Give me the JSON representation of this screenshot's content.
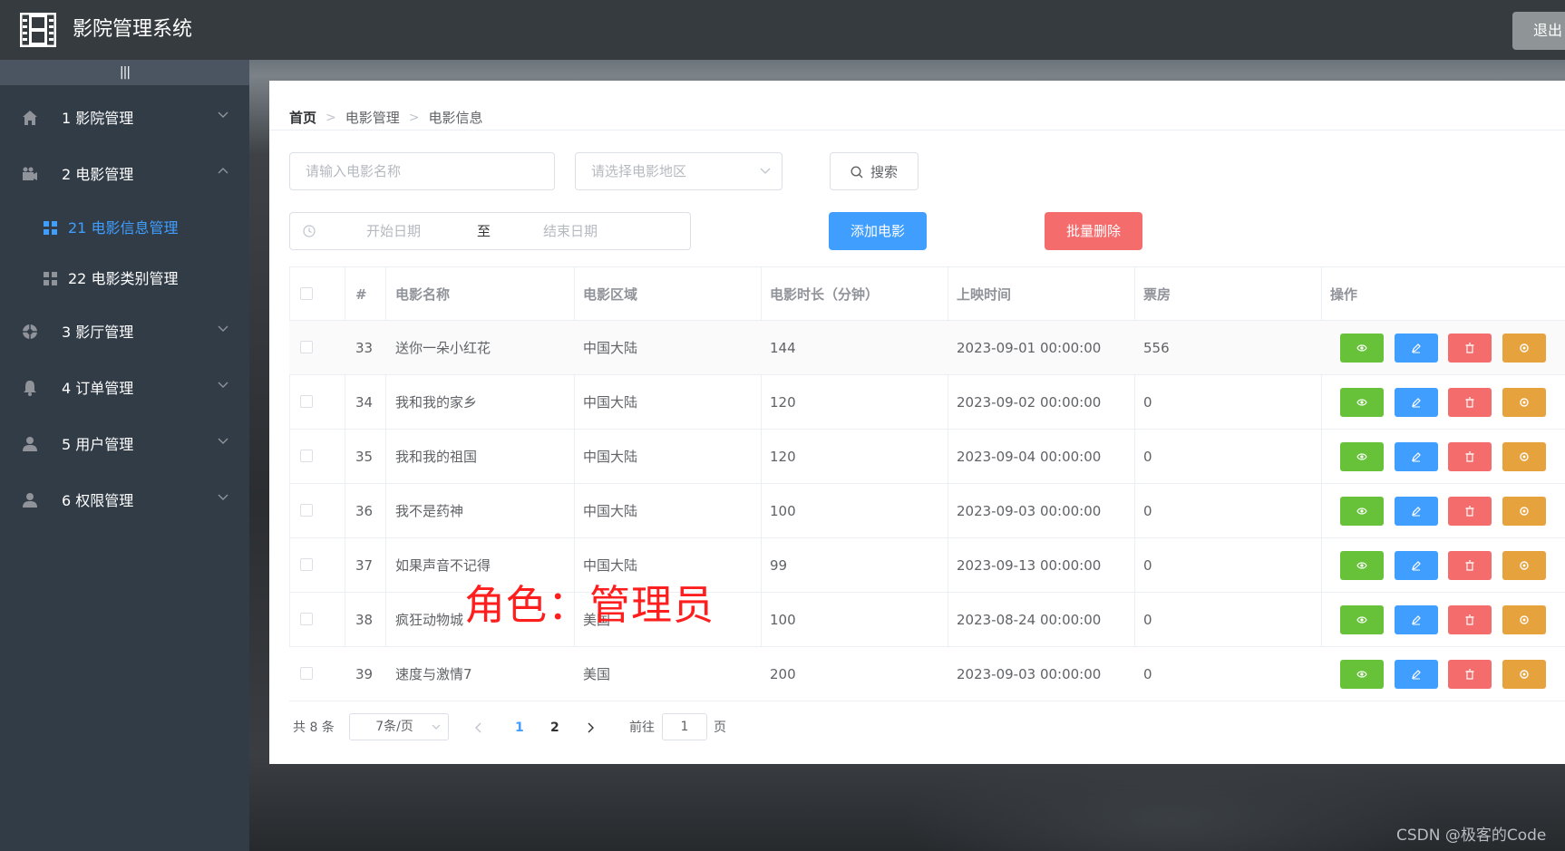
{
  "app": {
    "title": "影院管理系统",
    "logout_label": "退出"
  },
  "sidebar": {
    "collapse_glyph": "|||",
    "items": [
      {
        "label": "1 影院管理",
        "icon": "home-icon"
      },
      {
        "label": "2 电影管理",
        "icon": "camera-icon",
        "expanded": true,
        "children": [
          {
            "label": "21 电影信息管理",
            "active": true
          },
          {
            "label": "22 电影类别管理",
            "active": false
          }
        ]
      },
      {
        "label": "3 影厅管理",
        "icon": "disc-icon"
      },
      {
        "label": "4 订单管理",
        "icon": "bell-icon"
      },
      {
        "label": "5 用户管理",
        "icon": "user-icon"
      },
      {
        "label": "6 权限管理",
        "icon": "user-icon"
      }
    ]
  },
  "breadcrumb": [
    "首页",
    "电影管理",
    "电影信息"
  ],
  "filters": {
    "name_placeholder": "请输入电影名称",
    "region_placeholder": "请选择电影地区",
    "search_label": "搜索",
    "start_date_placeholder": "开始日期",
    "range_separator": "至",
    "end_date_placeholder": "结束日期",
    "add_label": "添加电影",
    "batch_delete_label": "批量删除"
  },
  "table": {
    "columns": [
      "#",
      "电影名称",
      "电影区域",
      "电影时长（分钟）",
      "上映时间",
      "票房",
      "操作"
    ],
    "rows": [
      {
        "id": "33",
        "name": "送你一朵小红花",
        "region": "中国大陆",
        "duration": "144",
        "release": "2023-09-01 00:00:00",
        "box_office": "556"
      },
      {
        "id": "34",
        "name": "我和我的家乡",
        "region": "中国大陆",
        "duration": "120",
        "release": "2023-09-02 00:00:00",
        "box_office": "0"
      },
      {
        "id": "35",
        "name": "我和我的祖国",
        "region": "中国大陆",
        "duration": "120",
        "release": "2023-09-04 00:00:00",
        "box_office": "0"
      },
      {
        "id": "36",
        "name": "我不是药神",
        "region": "中国大陆",
        "duration": "100",
        "release": "2023-09-03 00:00:00",
        "box_office": "0"
      },
      {
        "id": "37",
        "name": "如果声音不记得",
        "region": "中国大陆",
        "duration": "99",
        "release": "2023-09-13 00:00:00",
        "box_office": "0"
      },
      {
        "id": "38",
        "name": "疯狂动物城",
        "region": "美国",
        "duration": "100",
        "release": "2023-08-24 00:00:00",
        "box_office": "0"
      },
      {
        "id": "39",
        "name": "速度与激情7",
        "region": "美国",
        "duration": "200",
        "release": "2023-09-03 00:00:00",
        "box_office": "0"
      }
    ],
    "action_icons": [
      "eye-icon",
      "edit-icon",
      "delete-icon",
      "settings-icon"
    ]
  },
  "pagination": {
    "total": "共 8 条",
    "page_size": "7条/页",
    "pages": [
      "1",
      "2"
    ],
    "current_page": "1",
    "goto_prefix": "前往",
    "goto_value": "1",
    "goto_suffix": "页"
  },
  "overlay": {
    "role_note": "角色：管理员"
  },
  "watermark": "CSDN @极客的Code",
  "colors": {
    "primary": "#409eff",
    "success": "#67c23a",
    "danger": "#f56c6c",
    "warning": "#e6a23c",
    "sidebar_bg": "#313c47",
    "header_bg": "#353b3f",
    "note_red": "#ff1e1e"
  }
}
